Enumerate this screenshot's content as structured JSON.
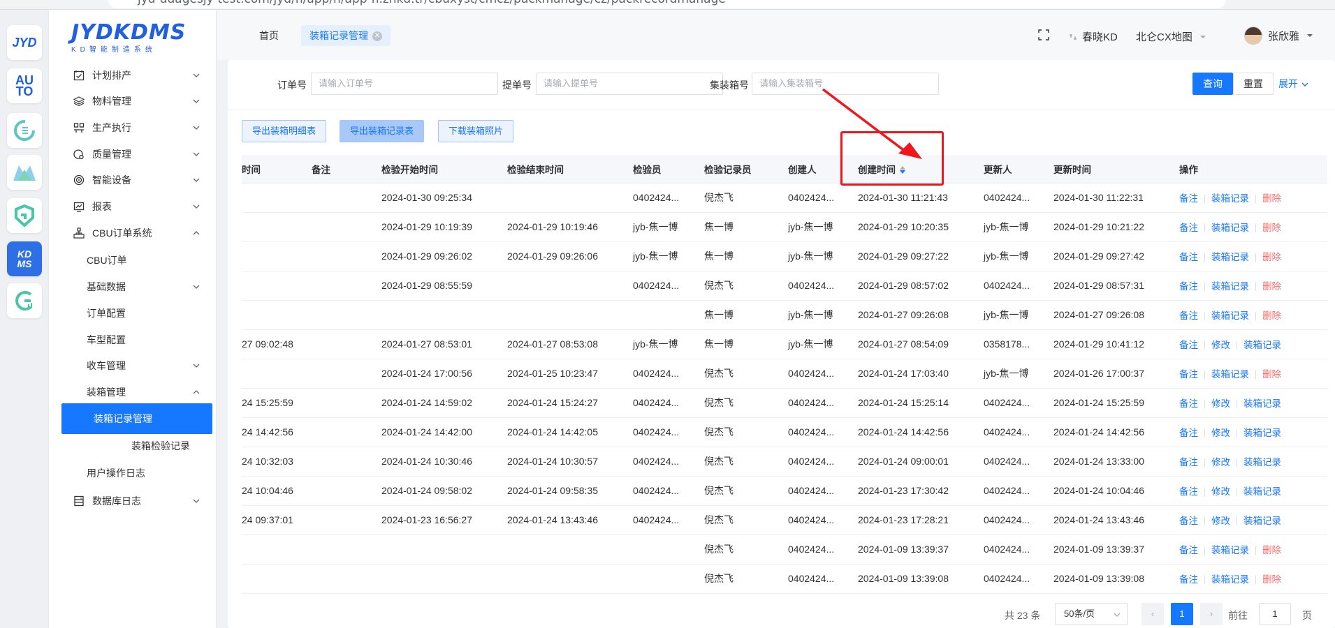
{
  "browser": {
    "url": "jyd-ddagesjy-test.com/jyd/h/app/h/app-h.zhkd.tr/cbuxyst/cmcz/packmanage/cz/packrecordmanage"
  },
  "sidebar": {
    "logo_brand": "JYDKDMS",
    "logo_slogan": "KD智能制造系统",
    "items": [
      {
        "label": "计划排产"
      },
      {
        "label": "物料管理"
      },
      {
        "label": "生产执行"
      },
      {
        "label": "质量管理"
      },
      {
        "label": "智能设备"
      },
      {
        "label": "报表"
      },
      {
        "label": "CBU订单系统"
      },
      {
        "label": "CBU订单"
      },
      {
        "label": "基础数据"
      },
      {
        "label": "订单配置"
      },
      {
        "label": "车型配置"
      },
      {
        "label": "收车管理"
      },
      {
        "label": "装箱管理"
      },
      {
        "label": "装箱记录管理"
      },
      {
        "label": "装箱检验记录"
      },
      {
        "label": "用户操作日志"
      },
      {
        "label": "数据库日志"
      }
    ]
  },
  "rail": {
    "items": [
      "JYD",
      "AU TO",
      "C",
      "M",
      "G",
      "KD MS",
      "G"
    ]
  },
  "topnav": {
    "tabs": [
      "首页",
      "装箱记录管理"
    ],
    "company": "春晓KD",
    "site": "北仑CX地图",
    "user": "张欣雅"
  },
  "filters": {
    "order_label": "订单号",
    "order_placeholder": "请输入订单号",
    "bill_label": "提单号",
    "bill_placeholder": "请输入提单号",
    "container_label": "集装箱号",
    "container_placeholder": "请输入集装箱号",
    "query": "查询",
    "reset": "重置",
    "expand": "展开"
  },
  "actions": {
    "export_detail": "导出装箱明细表",
    "export_record": "导出装箱记录表",
    "download_photos": "下载装箱照片"
  },
  "table": {
    "headers": [
      "时间",
      "备注",
      "检验开始时间",
      "检验结束时间",
      "检验员",
      "检验记录员",
      "创建人",
      "创建时间",
      "更新人",
      "更新时间",
      "操作"
    ],
    "rows": [
      {
        "time": "",
        "remark": "",
        "start": "2024-01-30 09:25:34",
        "end": "",
        "inspector": "0402424...",
        "recorder": "倪杰飞",
        "creator": "0402424...",
        "created": "2024-01-30 11:21:43",
        "updater": "0402424...",
        "updated": "2024-01-30 11:22:31",
        "ops": [
          "备注",
          "装箱记录",
          "删除"
        ]
      },
      {
        "time": "",
        "remark": "",
        "start": "2024-01-29 10:19:39",
        "end": "2024-01-29 10:19:46",
        "inspector": "jyb-焦一博",
        "recorder": "焦一博",
        "creator": "jyb-焦一博",
        "created": "2024-01-29 10:20:35",
        "updater": "jyb-焦一博",
        "updated": "2024-01-29 10:21:22",
        "ops": [
          "备注",
          "装箱记录",
          "删除"
        ]
      },
      {
        "time": "",
        "remark": "",
        "start": "2024-01-29 09:26:02",
        "end": "2024-01-29 09:26:06",
        "inspector": "jyb-焦一博",
        "recorder": "焦一博",
        "creator": "jyb-焦一博",
        "created": "2024-01-29 09:27:22",
        "updater": "jyb-焦一博",
        "updated": "2024-01-29 09:27:42",
        "ops": [
          "备注",
          "装箱记录",
          "删除"
        ]
      },
      {
        "time": "",
        "remark": "",
        "start": "2024-01-29 08:55:59",
        "end": "",
        "inspector": "0402424...",
        "recorder": "倪杰飞",
        "creator": "0402424...",
        "created": "2024-01-29 08:57:02",
        "updater": "0402424...",
        "updated": "2024-01-29 08:57:31",
        "ops": [
          "备注",
          "装箱记录",
          "删除"
        ]
      },
      {
        "time": "",
        "remark": "",
        "start": "",
        "end": "",
        "inspector": "",
        "recorder": "焦一博",
        "creator": "jyb-焦一博",
        "created": "2024-01-27 09:26:08",
        "updater": "jyb-焦一博",
        "updated": "2024-01-27 09:26:08",
        "ops": [
          "备注",
          "装箱记录",
          "删除"
        ]
      },
      {
        "time": "27 09:02:48",
        "remark": "",
        "start": "2024-01-27 08:53:01",
        "end": "2024-01-27 08:53:08",
        "inspector": "jyb-焦一博",
        "recorder": "焦一博",
        "creator": "jyb-焦一博",
        "created": "2024-01-27 08:54:09",
        "updater": "0358178...",
        "updated": "2024-01-29 10:41:12",
        "ops": [
          "备注",
          "修改",
          "装箱记录"
        ]
      },
      {
        "time": "",
        "remark": "",
        "start": "2024-01-24 17:00:56",
        "end": "2024-01-25 10:23:47",
        "inspector": "0402424...",
        "recorder": "倪杰飞",
        "creator": "0402424...",
        "created": "2024-01-24 17:03:40",
        "updater": "jyb-焦一博",
        "updated": "2024-01-26 17:00:37",
        "ops": [
          "备注",
          "装箱记录",
          "删除"
        ]
      },
      {
        "time": "24 15:25:59",
        "remark": "",
        "start": "2024-01-24 14:59:02",
        "end": "2024-01-24 15:24:27",
        "inspector": "0402424...",
        "recorder": "倪杰飞",
        "creator": "0402424...",
        "created": "2024-01-24 15:25:14",
        "updater": "0402424...",
        "updated": "2024-01-24 15:25:59",
        "ops": [
          "备注",
          "修改",
          "装箱记录"
        ]
      },
      {
        "time": "24 14:42:56",
        "remark": "",
        "start": "2024-01-24 14:42:00",
        "end": "2024-01-24 14:42:05",
        "inspector": "0402424...",
        "recorder": "倪杰飞",
        "creator": "0402424...",
        "created": "2024-01-24 14:42:56",
        "updater": "0402424...",
        "updated": "2024-01-24 14:42:56",
        "ops": [
          "备注",
          "修改",
          "装箱记录"
        ]
      },
      {
        "time": "24 10:32:03",
        "remark": "",
        "start": "2024-01-24 10:30:46",
        "end": "2024-01-24 10:30:57",
        "inspector": "0402424...",
        "recorder": "倪杰飞",
        "creator": "0402424...",
        "created": "2024-01-24 09:00:01",
        "updater": "0402424...",
        "updated": "2024-01-24 13:33:00",
        "ops": [
          "备注",
          "修改",
          "装箱记录"
        ]
      },
      {
        "time": "24 10:04:46",
        "remark": "",
        "start": "2024-01-24 09:58:02",
        "end": "2024-01-24 09:58:35",
        "inspector": "0402424...",
        "recorder": "倪杰飞",
        "creator": "0402424...",
        "created": "2024-01-23 17:30:42",
        "updater": "0402424...",
        "updated": "2024-01-24 10:04:46",
        "ops": [
          "备注",
          "修改",
          "装箱记录"
        ]
      },
      {
        "time": "24 09:37:01",
        "remark": "",
        "start": "2024-01-23 16:56:27",
        "end": "2024-01-24 13:43:46",
        "inspector": "0402424...",
        "recorder": "倪杰飞",
        "creator": "0402424...",
        "created": "2024-01-23 17:28:21",
        "updater": "0402424...",
        "updated": "2024-01-24 13:43:46",
        "ops": [
          "备注",
          "修改",
          "装箱记录"
        ]
      },
      {
        "time": "",
        "remark": "",
        "start": "",
        "end": "",
        "inspector": "",
        "recorder": "倪杰飞",
        "creator": "0402424...",
        "created": "2024-01-09 13:39:37",
        "updater": "0402424...",
        "updated": "2024-01-09 13:39:37",
        "ops": [
          "备注",
          "装箱记录",
          "删除"
        ]
      },
      {
        "time": "",
        "remark": "",
        "start": "",
        "end": "",
        "inspector": "",
        "recorder": "倪杰飞",
        "creator": "0402424...",
        "created": "2024-01-09 13:39:08",
        "updater": "0402424...",
        "updated": "2024-01-09 13:39:08",
        "ops": [
          "备注",
          "装箱记录",
          "删除"
        ]
      }
    ]
  },
  "pagination": {
    "total": "共 23 条",
    "page_size": "50条/页",
    "current_page": "1",
    "goto_label": "前往",
    "goto_value": "1",
    "page_suffix": "页"
  },
  "colors": {
    "primary": "#1677ff",
    "danger": "#f56c6c",
    "annotation": "#f0161c"
  }
}
